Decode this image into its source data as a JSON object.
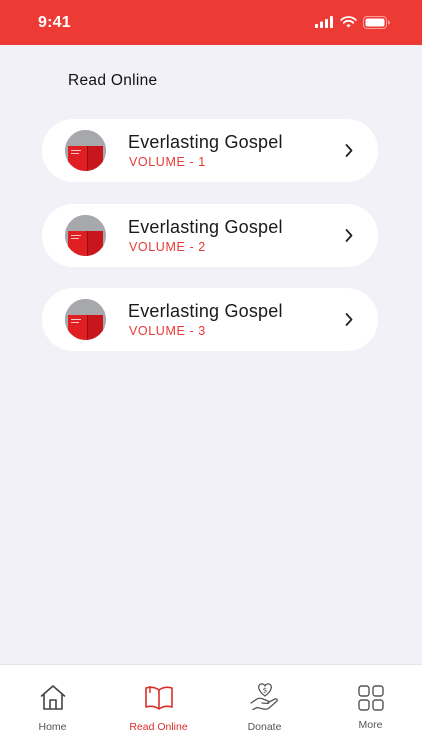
{
  "status": {
    "time": "9:41"
  },
  "page": {
    "title": "Read Online"
  },
  "books": [
    {
      "title": "Everlasting Gospel",
      "volume": "VOLUME - 1"
    },
    {
      "title": "Everlasting Gospel",
      "volume": "VOLUME - 2"
    },
    {
      "title": "Everlasting Gospel",
      "volume": "VOLUME - 3"
    }
  ],
  "tabs": [
    {
      "label": "Home",
      "icon": "home-icon",
      "active": false
    },
    {
      "label": "Read Online",
      "icon": "book-open-icon",
      "active": true
    },
    {
      "label": "Donate",
      "icon": "donate-hand-icon",
      "active": false
    },
    {
      "label": "More",
      "icon": "grid-icon",
      "active": false
    }
  ],
  "colors": {
    "accent": "#ee3a35",
    "background": "#f2f1f7",
    "active_tab": "#d92f2a"
  }
}
